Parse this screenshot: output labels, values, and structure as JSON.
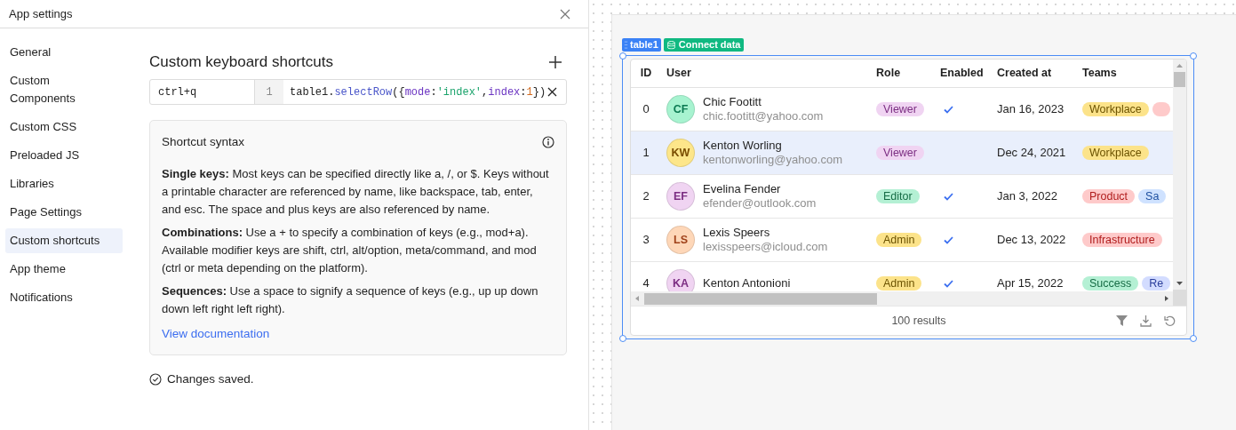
{
  "window": {
    "title": "App settings"
  },
  "sidebar": {
    "items": [
      {
        "label": "General",
        "selected": false
      },
      {
        "label": "Custom Components",
        "selected": false
      },
      {
        "label": "Custom CSS",
        "selected": false
      },
      {
        "label": "Preloaded JS",
        "selected": false
      },
      {
        "label": "Libraries",
        "selected": false
      },
      {
        "label": "Page Settings",
        "selected": false
      },
      {
        "label": "Custom shortcuts",
        "selected": true
      },
      {
        "label": "App theme",
        "selected": false
      },
      {
        "label": "Notifications",
        "selected": false
      }
    ]
  },
  "shortcuts": {
    "title": "Custom keyboard shortcuts",
    "items": [
      {
        "keys": "ctrl+q",
        "line_number": "1",
        "code": [
          {
            "text": "table1",
            "kind": "plain"
          },
          {
            "text": ".",
            "kind": "plain"
          },
          {
            "text": "selectRow",
            "kind": "method"
          },
          {
            "text": "({",
            "kind": "plain"
          },
          {
            "text": "mode",
            "kind": "key"
          },
          {
            "text": ":",
            "kind": "plain"
          },
          {
            "text": "'index'",
            "kind": "string"
          },
          {
            "text": ",",
            "kind": "plain"
          },
          {
            "text": "index",
            "kind": "key"
          },
          {
            "text": ":",
            "kind": "plain"
          },
          {
            "text": "1",
            "kind": "number"
          },
          {
            "text": "})",
            "kind": "plain"
          }
        ]
      }
    ]
  },
  "syntax": {
    "title": "Shortcut syntax",
    "paragraphs": [
      "**Single keys:** Most keys can be specified directly like a, /, or $. Keys without a printable character are referenced by name, like backspace, tab, enter, and esc. The space and plus keys are also referenced by name.",
      "**Combinations:** Use a + to specify a combination of keys (e.g., mod+a). Available modifier keys are shift, ctrl, alt/option, meta/command, and mod (ctrl or meta depending on the platform).",
      "**Sequences:** Use a space to signify a sequence of keys (e.g., up up down down left right left right)."
    ],
    "link": "View documentation"
  },
  "status": "Changes saved.",
  "canvas": {
    "component_label": "table1",
    "connect_label": "Connect data",
    "table": {
      "columns": [
        "ID",
        "User",
        "Role",
        "Enabled",
        "Created at",
        "Teams"
      ],
      "rows": [
        {
          "id": "0",
          "avatar": {
            "initials": "CF",
            "color": "#a7f3d0"
          },
          "name": "Chic Footitt",
          "email": "chic.footitt@yahoo.com",
          "role": {
            "label": "Viewer",
            "color": "#f0d4f2"
          },
          "enabled": true,
          "created": "Jan 16, 2023",
          "selected": false,
          "teams": [
            {
              "label": "Workplace",
              "color": "#fce38a"
            },
            {
              "color": "#fecaca"
            }
          ]
        },
        {
          "id": "1",
          "avatar": {
            "initials": "KW",
            "color": "#fde68a"
          },
          "name": "Kenton Worling",
          "email": "kentonworling@yahoo.com",
          "role": {
            "label": "Viewer",
            "color": "#f0d4f2"
          },
          "enabled": false,
          "created": "Dec 24, 2021",
          "selected": true,
          "teams": [
            {
              "label": "Workplace",
              "color": "#fce38a"
            }
          ]
        },
        {
          "id": "2",
          "avatar": {
            "initials": "EF",
            "color": "#f0d4f2"
          },
          "name": "Evelina Fender",
          "email": "efender@outlook.com",
          "role": {
            "label": "Editor",
            "color": "#b4f0d4"
          },
          "enabled": true,
          "created": "Jan 3, 2022",
          "selected": false,
          "teams": [
            {
              "label": "Product",
              "color": "#fecaca"
            },
            {
              "label": "Sa",
              "color": "#cfe2ff"
            }
          ]
        },
        {
          "id": "3",
          "avatar": {
            "initials": "LS",
            "color": "#fed7b8"
          },
          "name": "Lexis Speers",
          "email": "lexisspeers@icloud.com",
          "role": {
            "label": "Admin",
            "color": "#fce38a"
          },
          "enabled": true,
          "created": "Dec 13, 2022",
          "selected": false,
          "teams": [
            {
              "label": "Infrastructure",
              "color": "#fecaca"
            }
          ]
        },
        {
          "id": "4",
          "avatar": {
            "initials": "KA",
            "color": "#f0d4f2"
          },
          "name": "Kenton Antonioni",
          "role": {
            "label": "Admin",
            "color": "#fce38a"
          },
          "enabled": true,
          "created": "Apr 15, 2022",
          "selected": false,
          "teams": [
            {
              "label": "Success",
              "color": "#b4f0d4"
            },
            {
              "label": "Re",
              "color": "#d3dcff"
            }
          ]
        }
      ],
      "footer": "100 results"
    }
  }
}
